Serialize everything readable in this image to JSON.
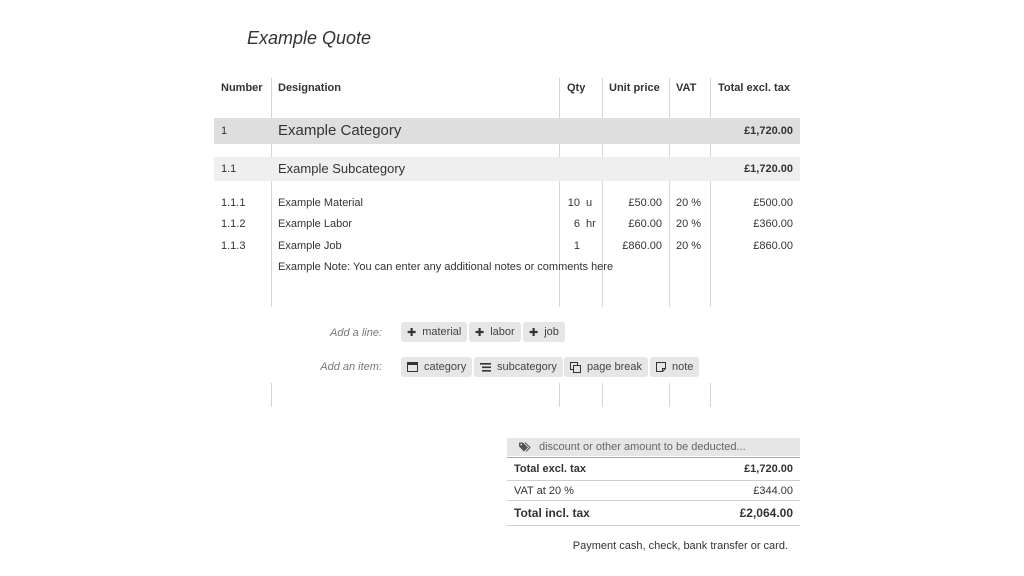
{
  "quote": {
    "title": "Example Quote"
  },
  "table": {
    "headers": {
      "number": "Number",
      "designation": "Designation",
      "qty": "Qty",
      "unit_price": "Unit price",
      "vat": "VAT",
      "total": "Total excl. tax"
    },
    "category": {
      "number": "1",
      "name": "Example Category",
      "total": "£1,720.00"
    },
    "subcategory": {
      "number": "1.1",
      "name": "Example Subcategory",
      "total": "£1,720.00"
    },
    "lines": [
      {
        "number": "1.1.1",
        "designation": "Example Material",
        "qty": "10",
        "unit": "u",
        "unit_price": "£50.00",
        "vat": "20 %",
        "total": "£500.00"
      },
      {
        "number": "1.1.2",
        "designation": "Example Labor",
        "qty": "6",
        "unit": "hr",
        "unit_price": "£60.00",
        "vat": "20 %",
        "total": "£360.00"
      },
      {
        "number": "1.1.3",
        "designation": "Example Job",
        "qty": "1",
        "unit": "",
        "unit_price": "£860.00",
        "vat": "20 %",
        "total": "£860.00"
      }
    ],
    "note": "Example Note: You can enter any additional notes or comments here"
  },
  "add_line": {
    "label": "Add a line:",
    "buttons": [
      {
        "label": "material",
        "icon": "plus-icon"
      },
      {
        "label": "labor",
        "icon": "plus-icon"
      },
      {
        "label": "job",
        "icon": "plus-icon"
      }
    ]
  },
  "add_item": {
    "label": "Add an item:",
    "buttons": [
      {
        "label": "category",
        "icon": "window-icon"
      },
      {
        "label": "subcategory",
        "icon": "list-icon"
      },
      {
        "label": "page break",
        "icon": "copy-icon"
      },
      {
        "label": "note",
        "icon": "note-icon"
      }
    ]
  },
  "totals": {
    "discount_placeholder": "discount or other amount to be deducted...",
    "excl_label": "Total excl. tax",
    "excl_value": "£1,720.00",
    "vat_label": "VAT at 20 %",
    "vat_value": "£344.00",
    "incl_label": "Total incl. tax",
    "incl_value": "£2,064.00"
  },
  "payment_text": "Payment cash, check, bank transfer or card."
}
